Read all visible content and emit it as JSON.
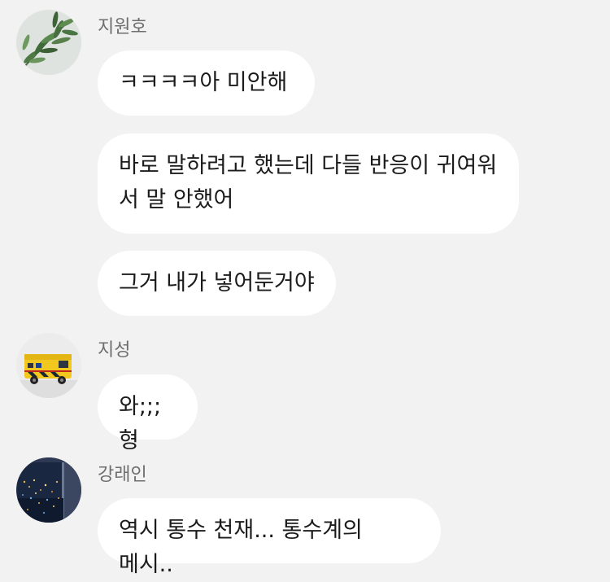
{
  "messages": [
    {
      "sender": "지원호",
      "bubbles": [
        "ㅋㅋㅋㅋ아 미안해",
        "바로 말하려고 했는데 다들 반응이 귀여워\n서 말 안했어",
        "그거 내가 넣어둔거야"
      ]
    },
    {
      "sender": "지성",
      "bubbles": [
        "와;;;형"
      ]
    },
    {
      "sender": "강래인",
      "bubbles": [
        "역시 통수 천재... 통수계의 메시.."
      ]
    }
  ],
  "avatars": [
    {
      "icon": "plant-leaves-avatar-icon"
    },
    {
      "icon": "ambulance-avatar-icon"
    },
    {
      "icon": "night-city-avatar-icon"
    }
  ],
  "colors": {
    "background": "#f2f2f2",
    "bubble": "#ffffff",
    "text": "#1b1b1b",
    "name": "#6e6e6e"
  }
}
